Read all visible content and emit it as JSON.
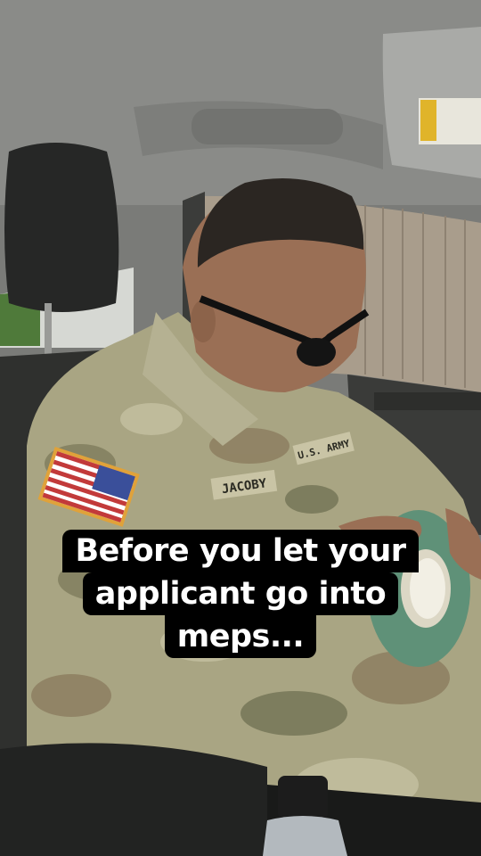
{
  "caption": {
    "lines": [
      "Before you let your",
      "applicant go into",
      "meps..."
    ]
  },
  "uniform": {
    "name_tape": "JACOBY",
    "branch_tape": "U.S. ARMY"
  },
  "colors": {
    "caption_bg": "#000000",
    "caption_text": "#ffffff",
    "tape_green": "#5f9178",
    "camo_base": "#a9a583"
  }
}
